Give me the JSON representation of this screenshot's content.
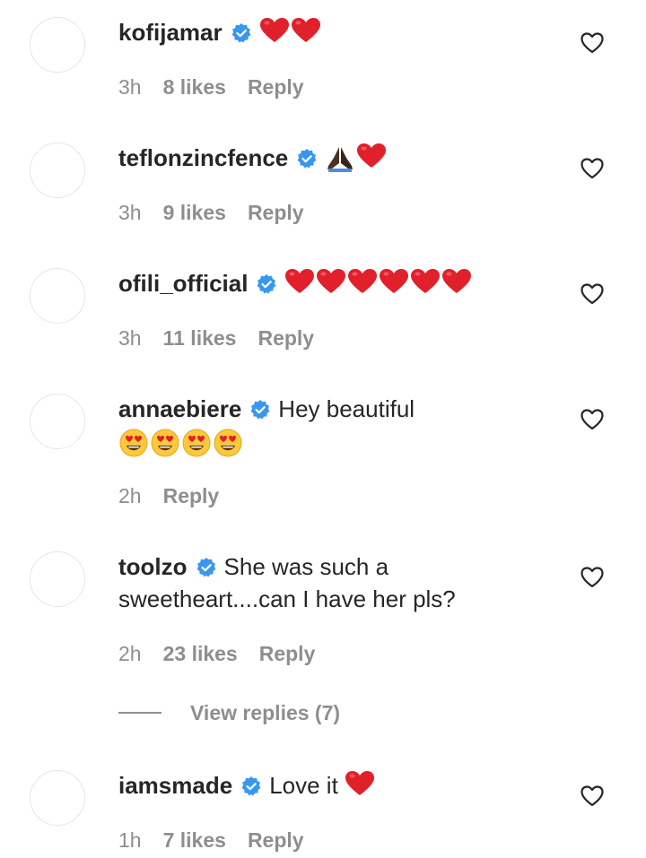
{
  "icons": {
    "verified": "verified-badge-icon",
    "like": "heart-outline-icon"
  },
  "colors": {
    "verified": "#3897f0",
    "heart_emoji": "#e0202a",
    "meta": "#8e8e8e"
  },
  "comments": [
    {
      "username": "kofijamar",
      "text": "",
      "time": "3h",
      "likes": "8 likes",
      "reply": "Reply"
    },
    {
      "username": "teflonzincfence",
      "text": "",
      "time": "3h",
      "likes": "9 likes",
      "reply": "Reply"
    },
    {
      "username": "ofili_official",
      "text": "",
      "time": "3h",
      "likes": "11 likes",
      "reply": "Reply"
    },
    {
      "username": "annaebiere",
      "text": "Hey beautiful",
      "time": "2h",
      "likes": "",
      "reply": "Reply"
    },
    {
      "username": "toolzo",
      "text": "She was such a sweetheart....can I have her pls?",
      "time": "2h",
      "likes": "23 likes",
      "reply": "Reply"
    },
    {
      "username": "iamsmade",
      "text": "Love it",
      "time": "1h",
      "likes": "7 likes",
      "reply": "Reply"
    }
  ],
  "view_replies": "View replies (7)"
}
